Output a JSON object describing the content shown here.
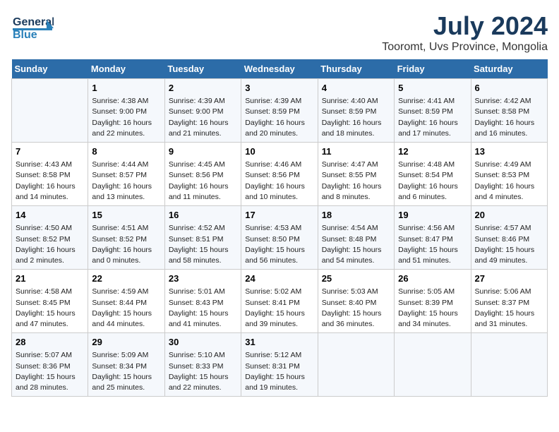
{
  "logo": {
    "text1": "General",
    "text2": "Blue"
  },
  "title": "July 2024",
  "location": "Tooromt, Uvs Province, Mongolia",
  "weekdays": [
    "Sunday",
    "Monday",
    "Tuesday",
    "Wednesday",
    "Thursday",
    "Friday",
    "Saturday"
  ],
  "weeks": [
    [
      {
        "day": "",
        "content": ""
      },
      {
        "day": "1",
        "content": "Sunrise: 4:38 AM\nSunset: 9:00 PM\nDaylight: 16 hours\nand 22 minutes."
      },
      {
        "day": "2",
        "content": "Sunrise: 4:39 AM\nSunset: 9:00 PM\nDaylight: 16 hours\nand 21 minutes."
      },
      {
        "day": "3",
        "content": "Sunrise: 4:39 AM\nSunset: 8:59 PM\nDaylight: 16 hours\nand 20 minutes."
      },
      {
        "day": "4",
        "content": "Sunrise: 4:40 AM\nSunset: 8:59 PM\nDaylight: 16 hours\nand 18 minutes."
      },
      {
        "day": "5",
        "content": "Sunrise: 4:41 AM\nSunset: 8:59 PM\nDaylight: 16 hours\nand 17 minutes."
      },
      {
        "day": "6",
        "content": "Sunrise: 4:42 AM\nSunset: 8:58 PM\nDaylight: 16 hours\nand 16 minutes."
      }
    ],
    [
      {
        "day": "7",
        "content": "Sunrise: 4:43 AM\nSunset: 8:58 PM\nDaylight: 16 hours\nand 14 minutes."
      },
      {
        "day": "8",
        "content": "Sunrise: 4:44 AM\nSunset: 8:57 PM\nDaylight: 16 hours\nand 13 minutes."
      },
      {
        "day": "9",
        "content": "Sunrise: 4:45 AM\nSunset: 8:56 PM\nDaylight: 16 hours\nand 11 minutes."
      },
      {
        "day": "10",
        "content": "Sunrise: 4:46 AM\nSunset: 8:56 PM\nDaylight: 16 hours\nand 10 minutes."
      },
      {
        "day": "11",
        "content": "Sunrise: 4:47 AM\nSunset: 8:55 PM\nDaylight: 16 hours\nand 8 minutes."
      },
      {
        "day": "12",
        "content": "Sunrise: 4:48 AM\nSunset: 8:54 PM\nDaylight: 16 hours\nand 6 minutes."
      },
      {
        "day": "13",
        "content": "Sunrise: 4:49 AM\nSunset: 8:53 PM\nDaylight: 16 hours\nand 4 minutes."
      }
    ],
    [
      {
        "day": "14",
        "content": "Sunrise: 4:50 AM\nSunset: 8:52 PM\nDaylight: 16 hours\nand 2 minutes."
      },
      {
        "day": "15",
        "content": "Sunrise: 4:51 AM\nSunset: 8:52 PM\nDaylight: 16 hours\nand 0 minutes."
      },
      {
        "day": "16",
        "content": "Sunrise: 4:52 AM\nSunset: 8:51 PM\nDaylight: 15 hours\nand 58 minutes."
      },
      {
        "day": "17",
        "content": "Sunrise: 4:53 AM\nSunset: 8:50 PM\nDaylight: 15 hours\nand 56 minutes."
      },
      {
        "day": "18",
        "content": "Sunrise: 4:54 AM\nSunset: 8:48 PM\nDaylight: 15 hours\nand 54 minutes."
      },
      {
        "day": "19",
        "content": "Sunrise: 4:56 AM\nSunset: 8:47 PM\nDaylight: 15 hours\nand 51 minutes."
      },
      {
        "day": "20",
        "content": "Sunrise: 4:57 AM\nSunset: 8:46 PM\nDaylight: 15 hours\nand 49 minutes."
      }
    ],
    [
      {
        "day": "21",
        "content": "Sunrise: 4:58 AM\nSunset: 8:45 PM\nDaylight: 15 hours\nand 47 minutes."
      },
      {
        "day": "22",
        "content": "Sunrise: 4:59 AM\nSunset: 8:44 PM\nDaylight: 15 hours\nand 44 minutes."
      },
      {
        "day": "23",
        "content": "Sunrise: 5:01 AM\nSunset: 8:43 PM\nDaylight: 15 hours\nand 41 minutes."
      },
      {
        "day": "24",
        "content": "Sunrise: 5:02 AM\nSunset: 8:41 PM\nDaylight: 15 hours\nand 39 minutes."
      },
      {
        "day": "25",
        "content": "Sunrise: 5:03 AM\nSunset: 8:40 PM\nDaylight: 15 hours\nand 36 minutes."
      },
      {
        "day": "26",
        "content": "Sunrise: 5:05 AM\nSunset: 8:39 PM\nDaylight: 15 hours\nand 34 minutes."
      },
      {
        "day": "27",
        "content": "Sunrise: 5:06 AM\nSunset: 8:37 PM\nDaylight: 15 hours\nand 31 minutes."
      }
    ],
    [
      {
        "day": "28",
        "content": "Sunrise: 5:07 AM\nSunset: 8:36 PM\nDaylight: 15 hours\nand 28 minutes."
      },
      {
        "day": "29",
        "content": "Sunrise: 5:09 AM\nSunset: 8:34 PM\nDaylight: 15 hours\nand 25 minutes."
      },
      {
        "day": "30",
        "content": "Sunrise: 5:10 AM\nSunset: 8:33 PM\nDaylight: 15 hours\nand 22 minutes."
      },
      {
        "day": "31",
        "content": "Sunrise: 5:12 AM\nSunset: 8:31 PM\nDaylight: 15 hours\nand 19 minutes."
      },
      {
        "day": "",
        "content": ""
      },
      {
        "day": "",
        "content": ""
      },
      {
        "day": "",
        "content": ""
      }
    ]
  ]
}
